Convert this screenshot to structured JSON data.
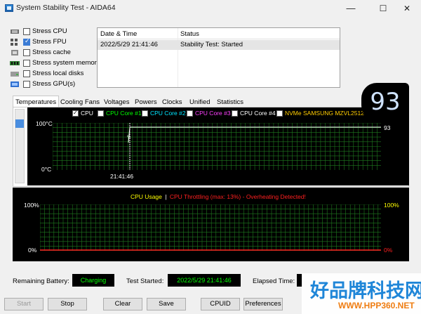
{
  "window": {
    "title": "System Stability Test - AIDA64",
    "minimize": "—",
    "maximize": "☐",
    "close": "✕"
  },
  "stress_options": [
    {
      "label": "Stress CPU",
      "checked": false,
      "icon": "cpu-icon"
    },
    {
      "label": "Stress FPU",
      "checked": true,
      "icon": "fpu-icon"
    },
    {
      "label": "Stress cache",
      "checked": false,
      "icon": "cache-icon"
    },
    {
      "label": "Stress system memory",
      "checked": false,
      "icon": "memory-icon"
    },
    {
      "label": "Stress local disks",
      "checked": false,
      "icon": "disk-icon"
    },
    {
      "label": "Stress GPU(s)",
      "checked": false,
      "icon": "gpu-icon"
    }
  ],
  "log": {
    "headers": [
      "Date & Time",
      "Status"
    ],
    "rows": [
      {
        "datetime": "2022/5/29 21:41:46",
        "status": "Stability Test: Started"
      }
    ]
  },
  "tabs": [
    "Temperatures",
    "Cooling Fans",
    "Voltages",
    "Powers",
    "Clocks",
    "Unified",
    "Statistics"
  ],
  "active_tab": "Temperatures",
  "temp_readout": "93",
  "temp_graph": {
    "legend": [
      {
        "label": "CPU",
        "checked": true,
        "color": "#ffffff"
      },
      {
        "label": "CPU Core #1",
        "checked": false,
        "color": "#00ff00"
      },
      {
        "label": "CPU Core #2",
        "checked": false,
        "color": "#00e5ff"
      },
      {
        "label": "CPU Core #3",
        "checked": false,
        "color": "#ff40ff"
      },
      {
        "label": "CPU Core #4",
        "checked": false,
        "color": "#ffffff"
      },
      {
        "label": "NVMe SAMSUNG MZVL2512",
        "checked": false,
        "color": "#ffcc00"
      }
    ],
    "y_max_label": "100°C",
    "y_min_label": "0°C",
    "x_label": "21:41:46",
    "current_value": "93",
    "marker_label": "%"
  },
  "cpu_graph": {
    "title_usage": "CPU Usage",
    "separator": "|",
    "title_throttle": "CPU Throttling (max: 13%) - Overheating Detected!",
    "left_max": "100%",
    "left_min": "0%",
    "right_max": "100%",
    "right_min": "0%",
    "usage_color": "#ffff00",
    "throttle_color": "#ff2020"
  },
  "status": {
    "battery_label": "Remaining Battery:",
    "battery_value": "Charging",
    "started_label": "Test Started:",
    "started_value": "2022/5/29 21:41:46",
    "elapsed_label": "Elapsed Time:"
  },
  "buttons": {
    "start": "Start",
    "stop": "Stop",
    "clear": "Clear",
    "save": "Save",
    "cpuid": "CPUID",
    "preferences": "Preferences"
  },
  "watermark": {
    "main": "好品牌科技网",
    "url": "WWW.HPP360.NET"
  }
}
